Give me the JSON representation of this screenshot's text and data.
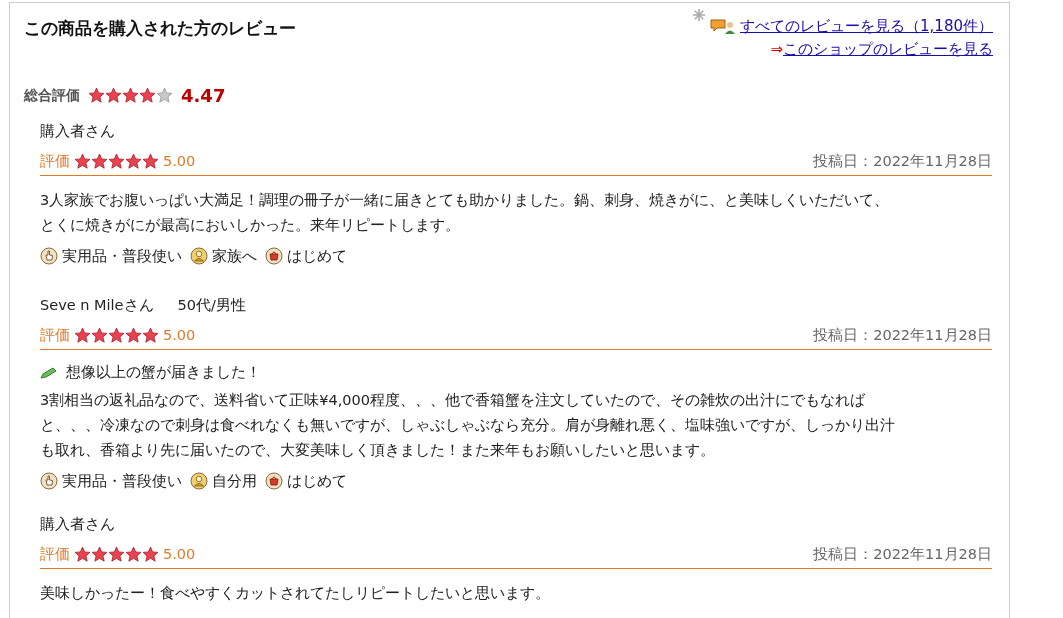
{
  "header": {
    "title": "この商品を購入された方のレビュー",
    "all_reviews_link": "すべてのレビューを見る（1,180件）",
    "shop_link_arrow": "⇒",
    "shop_link": "このショップのレビューを見る"
  },
  "overall": {
    "label": "総合評価",
    "stars": 4,
    "score": "4.47"
  },
  "reviews": [
    {
      "reviewer": "購入者さん",
      "rating_label": "評価",
      "stars": 5,
      "score": "5.00",
      "date": "投稿日：2022年11月28日",
      "body": [
        "3人家族でお腹いっぱい大満足！調理の冊子が一緒に届きとても助かりました。鍋、刺身、焼きがに、と美味しくいただいて、",
        "とくに焼きがにが最高においしかった。来年リピートします。"
      ],
      "tags": [
        {
          "kind": "usage",
          "label": "実用品・普段使い"
        },
        {
          "kind": "recipient",
          "label": "家族へ"
        },
        {
          "kind": "frequency",
          "label": "はじめて"
        }
      ]
    },
    {
      "reviewer": "Seve n Mileさん",
      "demographic": "50代/男性",
      "rating_label": "評価",
      "stars": 5,
      "score": "5.00",
      "date": "投稿日：2022年11月28日",
      "title": "想像以上の蟹が届きました！",
      "body": [
        "3割相当の返礼品なので、送料省いて正味¥4,000程度、、、他で香箱蟹を注文していたので、その雑炊の出汁にでもなれば",
        "と、、、冷凍なので刺身は食べれなくも無いですが、しゃぶしゃぶなら充分。肩が身離れ悪く、塩味強いですが、しっかり出汁",
        "も取れ、香箱より先に届いたので、大変美味しく頂きました！また来年もお願いしたいと思います。"
      ],
      "tags": [
        {
          "kind": "usage",
          "label": "実用品・普段使い"
        },
        {
          "kind": "recipient",
          "label": "自分用"
        },
        {
          "kind": "frequency",
          "label": "はじめて"
        }
      ]
    },
    {
      "reviewer": "購入者さん",
      "rating_label": "評価",
      "stars": 5,
      "score": "5.00",
      "date": "投稿日：2022年11月28日",
      "body": [
        "美味しかったー！食べやすくカットされてたしリピートしたいと思います。"
      ]
    }
  ]
}
